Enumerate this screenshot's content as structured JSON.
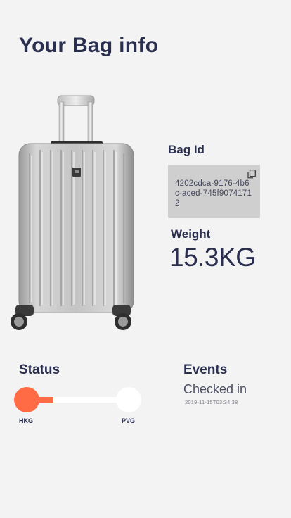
{
  "page": {
    "title": "Your Bag info"
  },
  "bag": {
    "id_label": "Bag Id",
    "id_value": "4202cdca-9176-4b6c-aced-745f90741712",
    "weight_label": "Weight",
    "weight_value": "15.3KG"
  },
  "status": {
    "label": "Status",
    "origin": "HKG",
    "destination": "PVG",
    "progress": 0.25
  },
  "events": {
    "label": "Events",
    "latest": "Checked in",
    "timestamp": "2019-11-15T03:34:38"
  },
  "icons": {
    "copy": "copy-icon"
  },
  "colors": {
    "accent": "#ff6b45",
    "text": "#2b2f4f",
    "background": "#f3f3f3",
    "id_box": "#cfcfcf"
  }
}
